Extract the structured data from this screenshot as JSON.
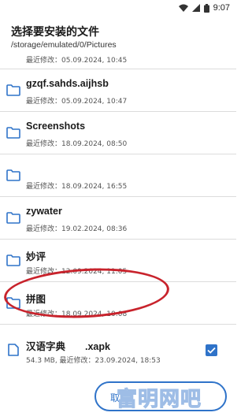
{
  "status_bar": {
    "time": "9:07"
  },
  "header": {
    "title": "选择要安装的文件",
    "path": "/storage/emulated/0/Pictures"
  },
  "partial_row": {
    "meta": "最近修改：05.09.2024, 10:45"
  },
  "rows": [
    {
      "name": "gzqf.sahds.aijhsb",
      "meta": "最近修改：05.09.2024, 10:47"
    },
    {
      "name": "Screenshots",
      "meta": "最近修改：18.09.2024, 08:50"
    },
    {
      "name": "",
      "meta": "最近修改：18.09.2024, 16:55"
    },
    {
      "name": "zywater",
      "meta": "最近修改：19.02.2024, 08:36"
    },
    {
      "name": "妙评",
      "meta": "最近修改：12.09.2024, 11:05"
    },
    {
      "name": "拼图",
      "meta": "最近修改：18.09.2024, 10:08"
    }
  ],
  "file_row": {
    "name": "汉语字典　　.xapk",
    "meta": "54.3 MB, 最近修改：23.09.2024, 18:53",
    "checked": true
  },
  "bottom_button": {
    "label": "取"
  },
  "watermark": "富明网吧",
  "colors": {
    "accent": "#2f73c9",
    "folder": "#2f73c9",
    "highlight": "#c8232c"
  }
}
